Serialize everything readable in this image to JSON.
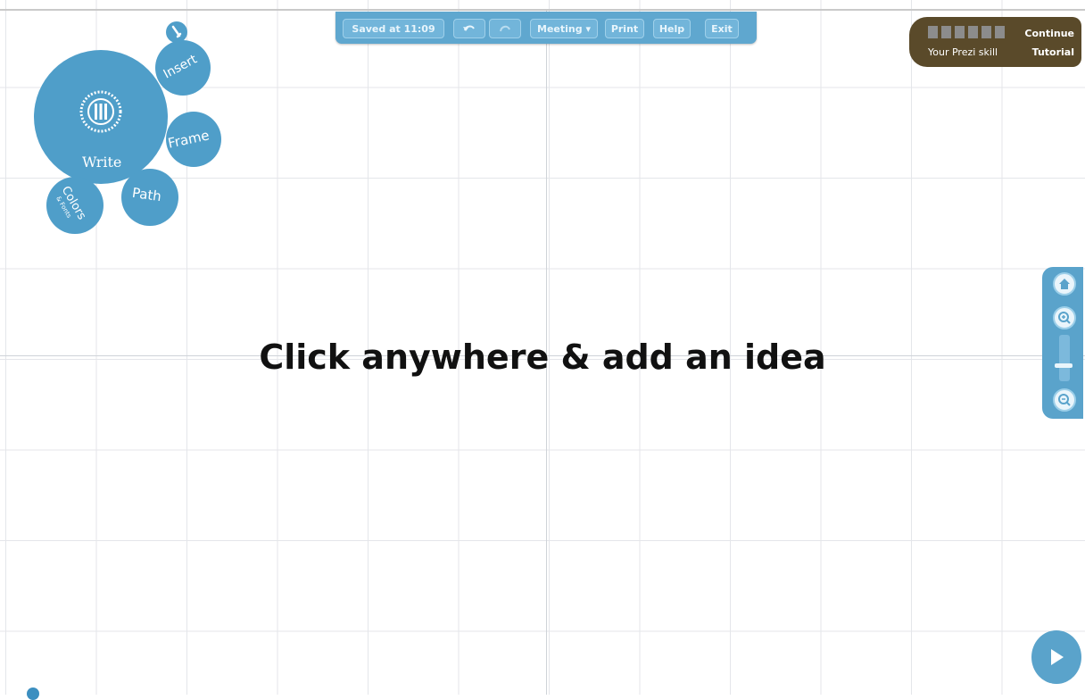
{
  "toolbar": {
    "saved_label": "Saved at 11:09",
    "undo_icon": "undo-icon",
    "redo_icon": "redo-icon",
    "meeting_label": "Meeting ▾",
    "print_label": "Print",
    "help_label": "Help",
    "exit_label": "Exit"
  },
  "skill": {
    "label": "Your Prezi skill",
    "cta_line1": "Continue",
    "cta_line2": "Tutorial",
    "level": 0
  },
  "bubble_menu": {
    "center_label": "Write",
    "items": [
      "Insert",
      "Frame",
      "Path",
      "Colors",
      "& Fonts"
    ]
  },
  "canvas": {
    "hint": "Click anywhere & add an idea"
  },
  "zoom": {
    "home_icon": "home-icon",
    "zoom_in_icon": "zoom-in-icon",
    "zoom_out_icon": "zoom-out-icon"
  },
  "show": {
    "label": "Show"
  },
  "colors": {
    "accent": "#4f9ec9",
    "toolbar": "#5fa7cf",
    "skill_bg": "#5a4a2a"
  }
}
